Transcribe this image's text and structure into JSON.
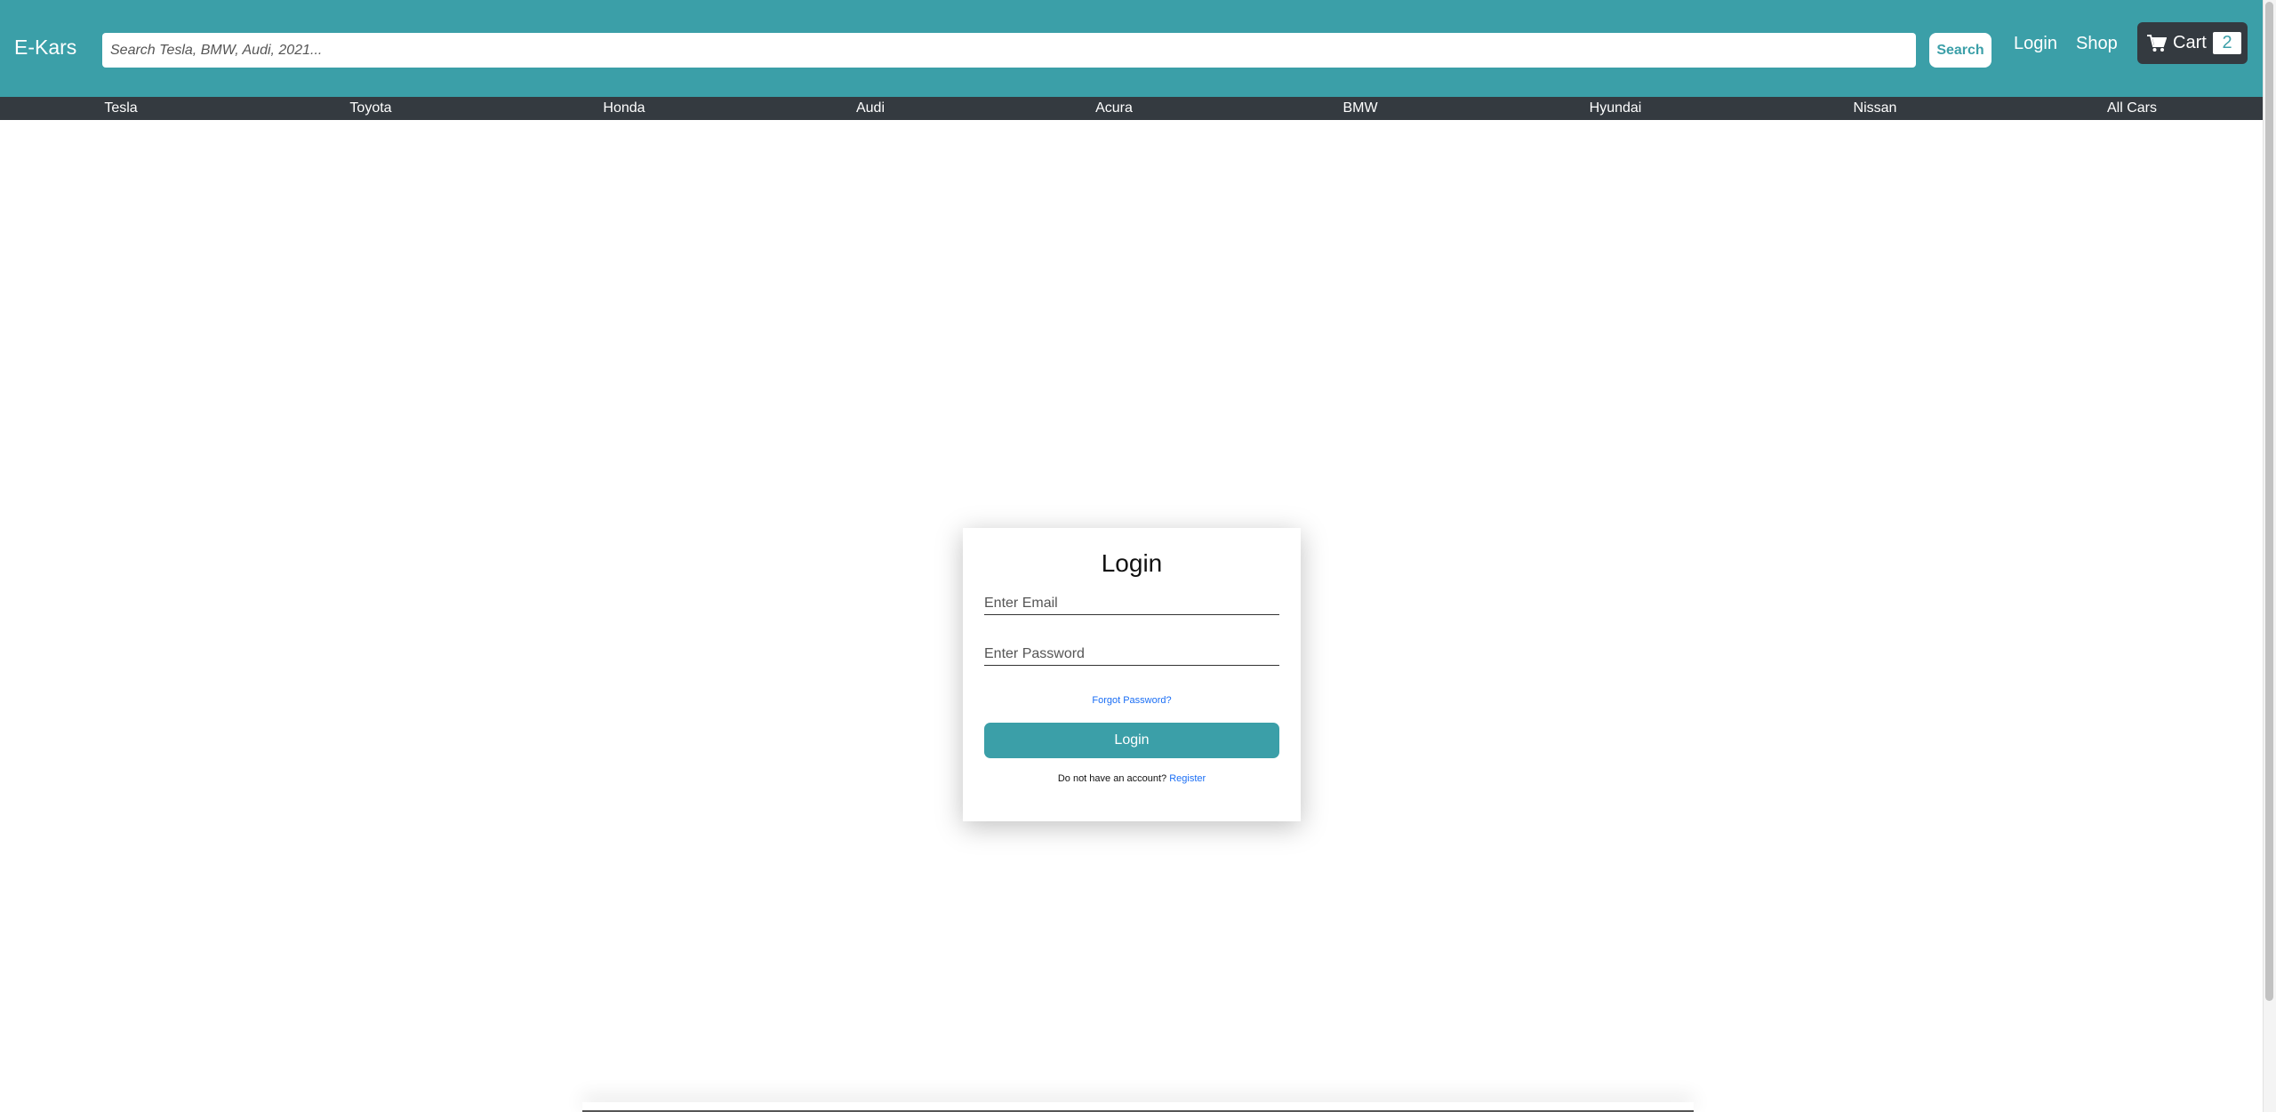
{
  "header": {
    "brand": "E-Kars",
    "search": {
      "placeholder": "Search Tesla, BMW, Audi, 2021...",
      "value": "",
      "button_label": "Search"
    },
    "nav": {
      "login": "Login",
      "shop": "Shop"
    },
    "cart": {
      "label": "Cart",
      "count": "2",
      "icon": "shopping-cart-icon"
    }
  },
  "categories": [
    "Tesla",
    "Toyota",
    "Honda",
    "Audi",
    "Acura",
    "BMW",
    "Hyundai",
    "Nissan",
    "All Cars"
  ],
  "login_form": {
    "title": "Login",
    "email": {
      "placeholder": "Enter Email",
      "value": ""
    },
    "password": {
      "placeholder": "Enter Password",
      "value": ""
    },
    "forgot_password": "Forgot Password?",
    "submit_label": "Login",
    "register_prompt": "Do not have an account?",
    "register_link": "Register"
  },
  "colors": {
    "primary": "#3b9fa8",
    "dark": "#343a40",
    "link": "#1a6ef5"
  }
}
